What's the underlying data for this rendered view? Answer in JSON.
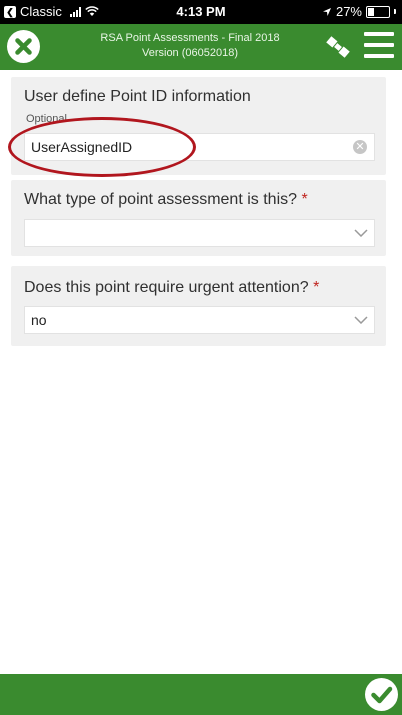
{
  "status_bar": {
    "back_app": "Classic",
    "time": "4:13 PM",
    "battery": "27%",
    "battery_level": 0.27
  },
  "header": {
    "title_line1": "RSA Point Assessments - Final 2018",
    "title_line2": "Version (06052018)",
    "close_icon": "close-circle-icon",
    "gps_icon": "satellite-icon",
    "menu_icon": "hamburger-menu-icon"
  },
  "questions": [
    {
      "label": "User define Point ID information",
      "hint": "Optional",
      "value": "UserAssignedID",
      "required": false
    },
    {
      "label": "What type of point assessment is this?",
      "value": "",
      "required": true
    },
    {
      "label": "Does this point require urgent attention?",
      "value": "no",
      "required": true
    }
  ],
  "required_marker": "*",
  "footer": {
    "submit_icon": "checkmark-circle-icon"
  },
  "colors": {
    "header_green": "#3a8b2f",
    "required_red": "#c0251f",
    "annotation_red": "#b1161e"
  }
}
